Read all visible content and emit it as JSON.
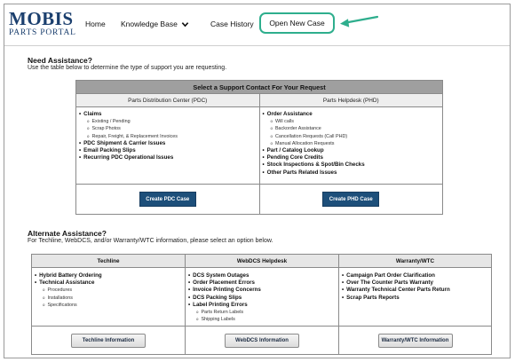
{
  "logo": {
    "main": "MOBIS",
    "sub": "PARTS PORTAL"
  },
  "nav": {
    "home": "Home",
    "knowledge_base": "Knowledge Base",
    "case_history": "Case History",
    "open_new_case": "Open New Case"
  },
  "colors": {
    "brand": "#1b3f6e",
    "highlight": "#2eae8d",
    "primary_button": "#1d4f7a",
    "table_header": "#9f9f9f"
  },
  "need_assistance": {
    "title": "Need Assistance?",
    "subtitle": "Use the table below to determine the type of support you are requesting."
  },
  "support_table": {
    "header": "Select a Support Contact For Your Request",
    "columns": [
      "Parts Distribution Center (PDC)",
      "Parts Helpdesk (PHD)"
    ],
    "pdc_items": [
      {
        "label": "Claims",
        "sub": [
          "Existing / Pending",
          "Scrap Photos",
          "Repair, Freight, & Replacement Invoices"
        ]
      },
      {
        "label": "PDC Shipment & Carrier Issues",
        "sub": []
      },
      {
        "label": "Email Packing Slips",
        "sub": []
      },
      {
        "label": "Recurring PDC Operational Issues",
        "sub": []
      }
    ],
    "phd_items": [
      {
        "label": "Order Assistance",
        "sub": [
          "Will calls",
          "Backorder Assistance",
          "Cancellation Requests (Call PHD)",
          "Manual Allocation Requests"
        ]
      },
      {
        "label": "Part / Catalog Lookup",
        "sub": []
      },
      {
        "label": "Pending Core Credits",
        "sub": []
      },
      {
        "label": "Stock Inspections & Spot/Bin Checks",
        "sub": []
      },
      {
        "label": "Other Parts Related Issues",
        "sub": []
      }
    ],
    "pdc_button": "Create PDC Case",
    "phd_button": "Create PHD Case"
  },
  "alternate_assistance": {
    "title": "Alternate Assistance?",
    "subtitle": "For Techline, WebDCS, and/or Warranty/WTC information, please select an option below."
  },
  "alt_table": {
    "columns": [
      "Techline",
      "WebDCS Helpdesk",
      "Warranty/WTC"
    ],
    "techline_items": [
      {
        "label": "Hybrid Battery Ordering",
        "sub": []
      },
      {
        "label": "Technical Assistance",
        "sub": [
          "Procedures",
          "Installations",
          "Specifications"
        ]
      }
    ],
    "webdcs_items": [
      {
        "label": "DCS System Outages",
        "sub": []
      },
      {
        "label": "Order Placement Errors",
        "sub": []
      },
      {
        "label": "Invoice Printing Concerns",
        "sub": []
      },
      {
        "label": "DCS Packing Slips",
        "sub": []
      },
      {
        "label": "Label Printing Errors",
        "sub": [
          "Parts Return Labels",
          "Shipping Labels"
        ]
      }
    ],
    "warranty_items": [
      {
        "label": "Campaign Part Order Clarification",
        "sub": []
      },
      {
        "label": "Over The Counter Parts Warranty",
        "sub": []
      },
      {
        "label": "Warranty Technical Center Parts Return",
        "sub": []
      },
      {
        "label": "Scrap Parts Reports",
        "sub": []
      }
    ],
    "buttons": [
      "Techline Information",
      "WebDCS Information",
      "Warranty/WTC Information"
    ]
  }
}
